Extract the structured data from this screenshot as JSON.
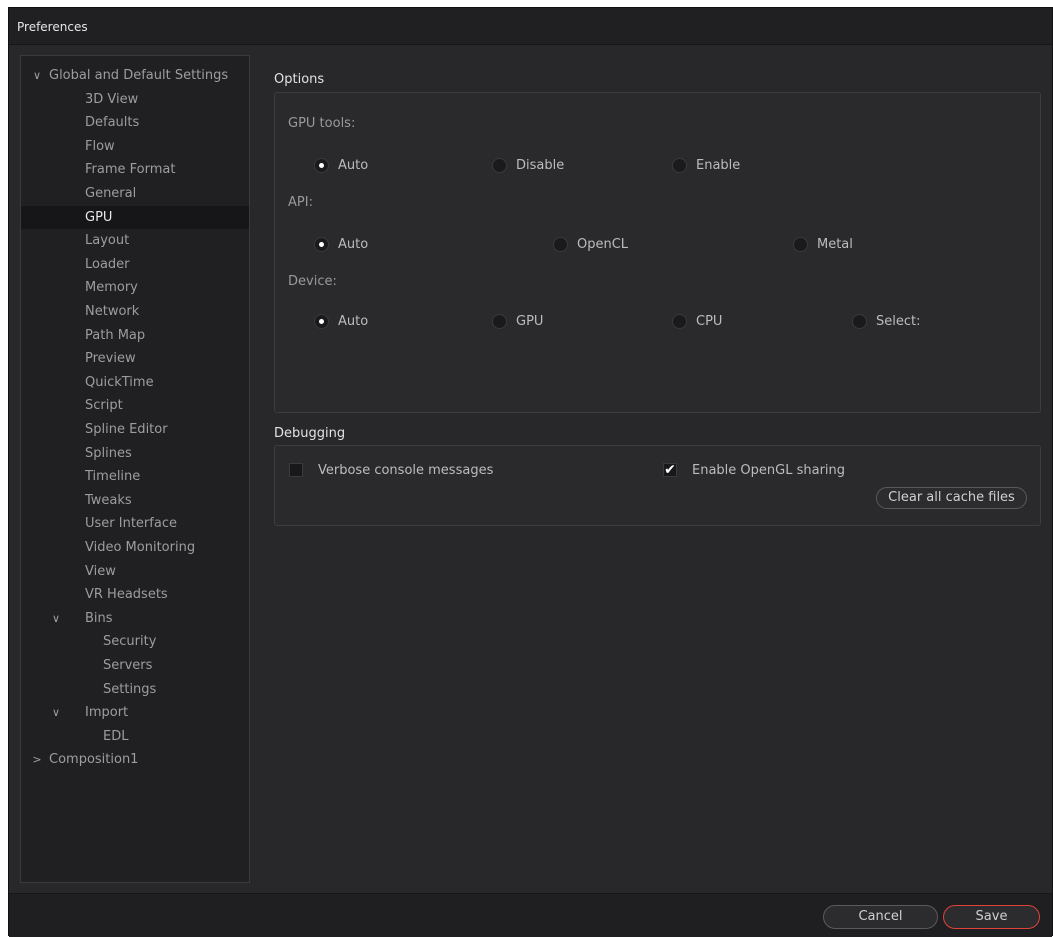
{
  "window": {
    "title": "Preferences"
  },
  "tree": {
    "items": [
      {
        "label": "Global and Default Settings",
        "level": 0,
        "expander": "expanded",
        "selected": false
      },
      {
        "label": "3D View",
        "level": 1,
        "selected": false
      },
      {
        "label": "Defaults",
        "level": 1,
        "selected": false
      },
      {
        "label": "Flow",
        "level": 1,
        "selected": false
      },
      {
        "label": "Frame Format",
        "level": 1,
        "selected": false
      },
      {
        "label": "General",
        "level": 1,
        "selected": false
      },
      {
        "label": "GPU",
        "level": 1,
        "selected": true
      },
      {
        "label": "Layout",
        "level": 1,
        "selected": false
      },
      {
        "label": "Loader",
        "level": 1,
        "selected": false
      },
      {
        "label": "Memory",
        "level": 1,
        "selected": false
      },
      {
        "label": "Network",
        "level": 1,
        "selected": false
      },
      {
        "label": "Path Map",
        "level": 1,
        "selected": false
      },
      {
        "label": "Preview",
        "level": 1,
        "selected": false
      },
      {
        "label": "QuickTime",
        "level": 1,
        "selected": false
      },
      {
        "label": "Script",
        "level": 1,
        "selected": false
      },
      {
        "label": "Spline Editor",
        "level": 1,
        "selected": false
      },
      {
        "label": "Splines",
        "level": 1,
        "selected": false
      },
      {
        "label": "Timeline",
        "level": 1,
        "selected": false
      },
      {
        "label": "Tweaks",
        "level": 1,
        "selected": false
      },
      {
        "label": "User Interface",
        "level": 1,
        "selected": false
      },
      {
        "label": "Video Monitoring",
        "level": 1,
        "selected": false
      },
      {
        "label": "View",
        "level": 1,
        "selected": false
      },
      {
        "label": "VR Headsets",
        "level": 1,
        "selected": false
      },
      {
        "label": "Bins",
        "level": 1,
        "expander": "expanded",
        "selected": false
      },
      {
        "label": "Security",
        "level": 2,
        "selected": false
      },
      {
        "label": "Servers",
        "level": 2,
        "selected": false
      },
      {
        "label": "Settings",
        "level": 2,
        "selected": false
      },
      {
        "label": "Import",
        "level": 1,
        "expander": "expanded",
        "selected": false
      },
      {
        "label": "EDL",
        "level": 2,
        "selected": false
      },
      {
        "label": "Composition1",
        "level": 0,
        "expander": "collapsed",
        "selected": false
      }
    ]
  },
  "options": {
    "title": "Options",
    "gpu_tools": {
      "label": "GPU tools:",
      "choices": [
        {
          "label": "Auto",
          "selected": true
        },
        {
          "label": "Disable",
          "selected": false
        },
        {
          "label": "Enable",
          "selected": false
        }
      ]
    },
    "api": {
      "label": "API:",
      "choices": [
        {
          "label": "Auto",
          "selected": true
        },
        {
          "label": "OpenCL",
          "selected": false
        },
        {
          "label": "Metal",
          "selected": false
        }
      ]
    },
    "device": {
      "label": "Device:",
      "choices": [
        {
          "label": "Auto",
          "selected": true
        },
        {
          "label": "GPU",
          "selected": false
        },
        {
          "label": "CPU",
          "selected": false
        },
        {
          "label": "Select:",
          "selected": false
        }
      ]
    }
  },
  "debugging": {
    "title": "Debugging",
    "verbose": {
      "label": "Verbose console messages",
      "checked": false
    },
    "opengl": {
      "label": "Enable OpenGL sharing",
      "checked": true
    },
    "clear_cache_label": "Clear all cache files"
  },
  "footer": {
    "cancel_label": "Cancel",
    "save_label": "Save",
    "save_accent": "#e0413a"
  },
  "icons": {
    "expanded": "chevron-down-icon",
    "collapsed": "chevron-right-icon",
    "check": "checkmark-icon"
  }
}
